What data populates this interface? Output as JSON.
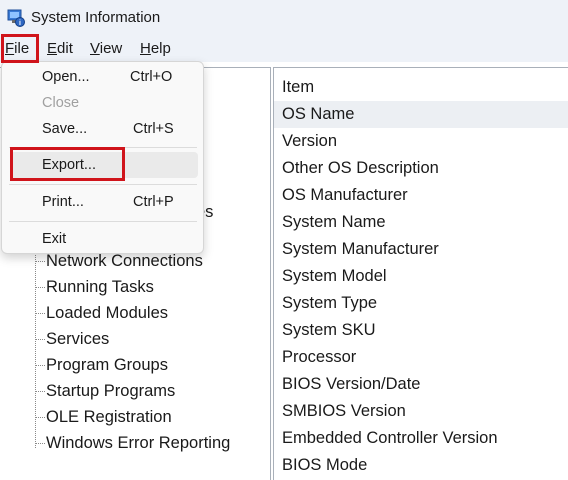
{
  "window": {
    "title": "System Information"
  },
  "menubar": {
    "file": {
      "accel": "F",
      "rest": "ile"
    },
    "edit": {
      "accel": "E",
      "rest": "dit"
    },
    "view": {
      "accel": "V",
      "rest": "iew"
    },
    "help": {
      "accel": "H",
      "rest": "elp"
    }
  },
  "file_menu": {
    "open": {
      "label": "Open...",
      "shortcut": "Ctrl+O"
    },
    "close": {
      "label": "Close"
    },
    "save": {
      "label": "Save...",
      "shortcut": "Ctrl+S"
    },
    "export": {
      "label": "Export..."
    },
    "print": {
      "label": "Print...",
      "shortcut": "Ctrl+P"
    },
    "exit": {
      "label": "Exit"
    }
  },
  "tree": {
    "partial_label": "es",
    "items": [
      "Network Connections",
      "Running Tasks",
      "Loaded Modules",
      "Services",
      "Program Groups",
      "Startup Programs",
      "OLE Registration",
      "Windows Error Reporting"
    ]
  },
  "details": {
    "header": "Item",
    "rows": [
      "OS Name",
      "Version",
      "Other OS Description",
      "OS Manufacturer",
      "System Name",
      "System Manufacturer",
      "System Model",
      "System Type",
      "System SKU",
      "Processor",
      "BIOS Version/Date",
      "SMBIOS Version",
      "Embedded Controller Version",
      "BIOS Mode"
    ],
    "selected_row": "OS Name"
  },
  "icons": {
    "app": "system-information-icon"
  },
  "colors": {
    "highlight": "#d0141b",
    "background": "#eef2f8"
  }
}
